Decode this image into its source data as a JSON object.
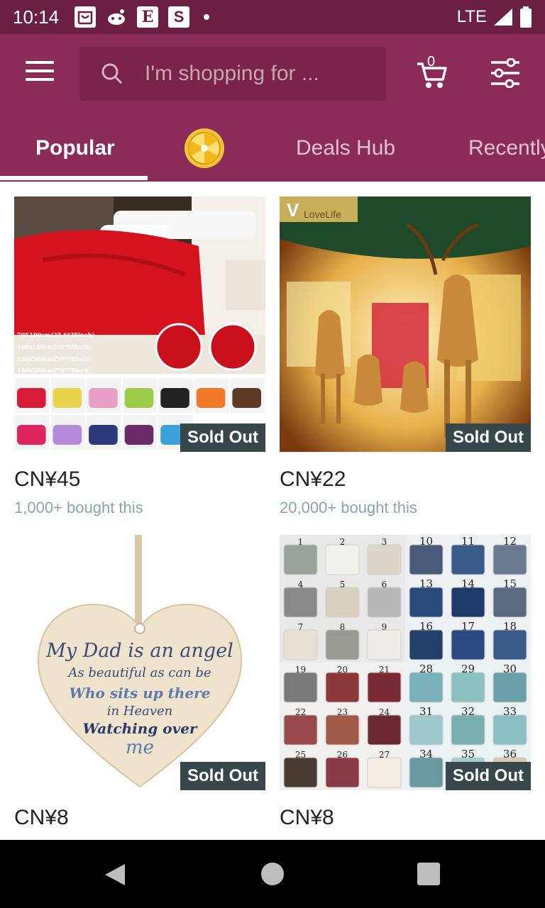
{
  "status_bar": {
    "time": "10:14",
    "icons": [
      "bag-icon",
      "reddit-icon",
      "etsy-icon",
      "s-app-icon",
      "dot-icon"
    ],
    "etsy_letter": "E",
    "s_letter": "S",
    "network": "LTE"
  },
  "header": {
    "search_placeholder": "I'm shopping for ...",
    "cart_count": "0"
  },
  "tabs": [
    {
      "label": "Popular",
      "active": true
    },
    {
      "label": "",
      "icon": "prize-wheel-icon"
    },
    {
      "label": "Deals Hub"
    },
    {
      "label": "Recently"
    }
  ],
  "products": [
    {
      "price": "CN¥45",
      "bought": "1,000+ bought this",
      "badge": "Sold Out",
      "image": "red-blanket-photo",
      "image_text": [
        "70X100cm(25.6*39inch)",
        "100x140cm(39*55inch)",
        "150x200cm(59*78inch)",
        "180x200cm(70*78inch)"
      ],
      "swatches": [
        "#d81b36",
        "#e8d44d",
        "#e89fc5",
        "#9ccc4a",
        "#222222",
        "#f07a2a",
        "#5d3a26",
        "#e0245e",
        "#b58ad8",
        "#283a7a",
        "#6a2a6a",
        "#3aa0d8"
      ]
    },
    {
      "price": "CN¥22",
      "bought": "20,000+ bought this",
      "badge": "Sold Out",
      "image": "christmas-reindeer-photo",
      "brand": "LoveLife"
    },
    {
      "price": "CN¥8",
      "badge": "Sold Out",
      "image": "wooden-heart-plaque-photo",
      "plaque_lines": [
        "My Dad is an angel",
        "As beautiful as can be",
        "Who sits up there",
        "in Heaven",
        "Watching over",
        "me"
      ]
    },
    {
      "price": "CN¥8",
      "badge": "Sold Out",
      "image": "cushion-covers-collage-photo",
      "numbers": [
        "1",
        "2",
        "3",
        "10",
        "11",
        "12",
        "4",
        "5",
        "6",
        "13",
        "14",
        "15",
        "7",
        "8",
        "9",
        "16",
        "17",
        "18",
        "19",
        "20",
        "21",
        "28",
        "29",
        "30",
        "22",
        "23",
        "24",
        "31",
        "32",
        "33",
        "25",
        "26",
        "27",
        "34",
        "35",
        "36"
      ]
    }
  ],
  "colors": {
    "status_bar": "#6b1f43",
    "header": "#8a2c57",
    "badge": "#37474a",
    "bought_text": "#8aa3b0"
  }
}
